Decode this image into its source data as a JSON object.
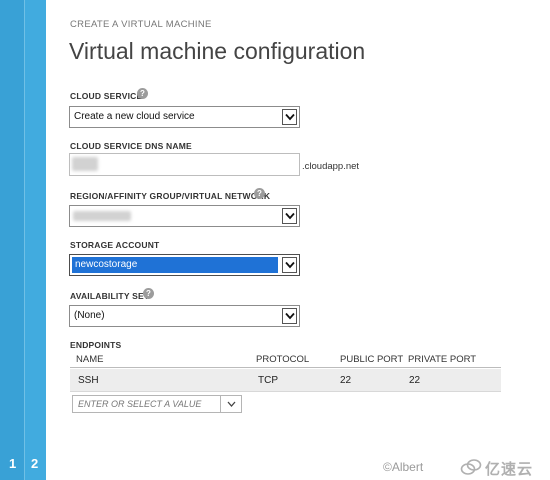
{
  "wizard": {
    "eyebrow": "CREATE A VIRTUAL MACHINE",
    "title": "Virtual machine configuration",
    "steps": [
      "1",
      "2"
    ],
    "accent_color": "#39a1d6"
  },
  "form": {
    "cloud_service": {
      "label": "CLOUD SERVICE",
      "selected": "Create a new cloud service",
      "help_icon": "question-circle-icon"
    },
    "dns_name": {
      "label": "CLOUD SERVICE DNS NAME",
      "suffix": ".cloudapp.net"
    },
    "region": {
      "label": "REGION/AFFINITY GROUP/VIRTUAL NETWORK",
      "help_icon": "question-circle-icon"
    },
    "storage": {
      "label": "STORAGE ACCOUNT",
      "selected": "newcostorage",
      "highlight_color": "#1f72d6"
    },
    "availability": {
      "label": "AVAILABILITY SET",
      "selected": "(None)",
      "help_icon": "question-circle-icon"
    }
  },
  "endpoints": {
    "label": "ENDPOINTS",
    "columns": [
      "NAME",
      "PROTOCOL",
      "PUBLIC PORT",
      "PRIVATE PORT"
    ],
    "rows": [
      {
        "name": "SSH",
        "protocol": "TCP",
        "public_port": "22",
        "private_port": "22"
      }
    ],
    "add_placeholder": "ENTER OR SELECT A VALUE"
  },
  "watermark": {
    "author": "©Albert",
    "brand": "亿速云"
  }
}
